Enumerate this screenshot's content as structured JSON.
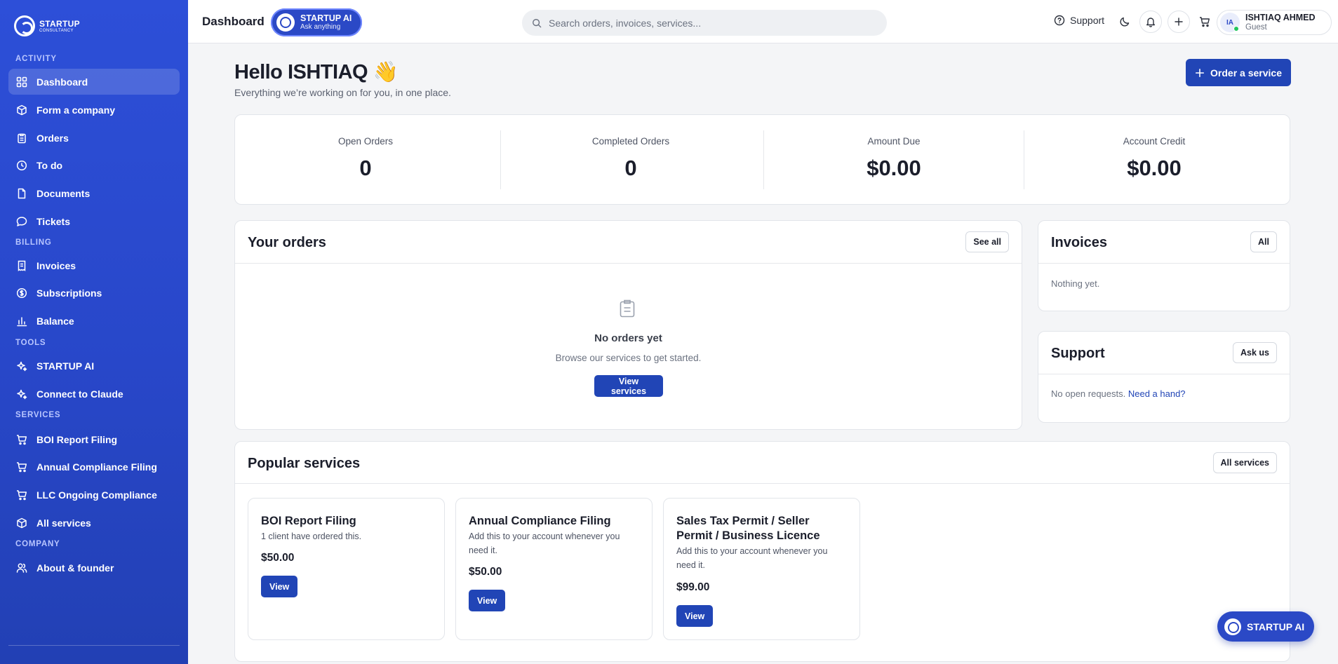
{
  "brand": {
    "name": "STARTUP",
    "tagline": "CONSULTANCY"
  },
  "sidebar": {
    "sections": {
      "activity": "ACTIVITY",
      "billing": "BILLING",
      "tools": "TOOLS",
      "services": "SERVICES",
      "company": "COMPANY"
    },
    "items": [
      {
        "label": "Dashboard",
        "icon": "dashboard-grid-icon",
        "active": true
      },
      {
        "label": "Form a company",
        "icon": "cube-icon"
      },
      {
        "label": "Orders",
        "icon": "clipboard-icon"
      },
      {
        "label": "To do",
        "icon": "clock-icon"
      },
      {
        "label": "Documents",
        "icon": "document-icon"
      },
      {
        "label": "Tickets",
        "icon": "chat-bubble-icon"
      },
      {
        "label": "Invoices",
        "icon": "receipt-icon"
      },
      {
        "label": "Subscriptions",
        "icon": "dollar-circle-icon"
      },
      {
        "label": "Balance",
        "icon": "bar-chart-icon"
      },
      {
        "label": "STARTUP AI",
        "icon": "sparkle-icon"
      },
      {
        "label": "Connect to Claude",
        "icon": "sparkle-icon"
      },
      {
        "label": "BOI Report Filing",
        "icon": "cart-icon"
      },
      {
        "label": "Annual Compliance Filing",
        "icon": "cart-icon"
      },
      {
        "label": "LLC Ongoing Compliance",
        "icon": "cart-icon"
      },
      {
        "label": "All services",
        "icon": "cube-icon"
      },
      {
        "label": "About & founder",
        "icon": "users-icon"
      }
    ]
  },
  "header": {
    "title": "Dashboard",
    "ai_pill": {
      "title": "STARTUP AI",
      "subtitle": "Ask anything"
    },
    "search_placeholder": "Search orders, invoices, services...",
    "support_label": "Support",
    "user": {
      "initials": "IA",
      "name": "ISHTIAQ AHMED",
      "role": "Guest"
    }
  },
  "greeting": {
    "title": "Hello ISHTIAQ",
    "emoji": "👋",
    "subtitle": "Everything we’re working on for you, in one place."
  },
  "order_button": "Order a service",
  "stats": [
    {
      "label": "Open Orders",
      "value": "0"
    },
    {
      "label": "Completed Orders",
      "value": "0"
    },
    {
      "label": "Amount Due",
      "value": "$0.00"
    },
    {
      "label": "Account Credit",
      "value": "$0.00"
    }
  ],
  "orders": {
    "title": "Your orders",
    "see_all": "See all",
    "empty_title": "No orders yet",
    "empty_subtitle": "Browse our services to get started.",
    "view_services": "View services"
  },
  "invoices": {
    "title": "Invoices",
    "all": "All",
    "empty": "Nothing yet."
  },
  "support": {
    "title": "Support",
    "ask_us": "Ask us",
    "status": "No open requests.",
    "link": "Need a hand?"
  },
  "popular": {
    "title": "Popular services",
    "all_services": "All services",
    "services": [
      {
        "name": "BOI Report Filing",
        "desc": "1 client have ordered this.",
        "price": "$50.00",
        "cta": "View"
      },
      {
        "name": "Annual Compliance Filing",
        "desc": "Add this to your account whenever you need it.",
        "price": "$50.00",
        "cta": "View"
      },
      {
        "name": "Sales Tax Permit / Seller Permit / Business Licence",
        "desc": "Add this to your account whenever you need it.",
        "price": "$99.00",
        "cta": "View"
      }
    ]
  },
  "fab_label": "STARTUP AI",
  "colors": {
    "sidebar": "#2d4fd8",
    "primary": "#2145b6",
    "online": "#22c55e"
  }
}
